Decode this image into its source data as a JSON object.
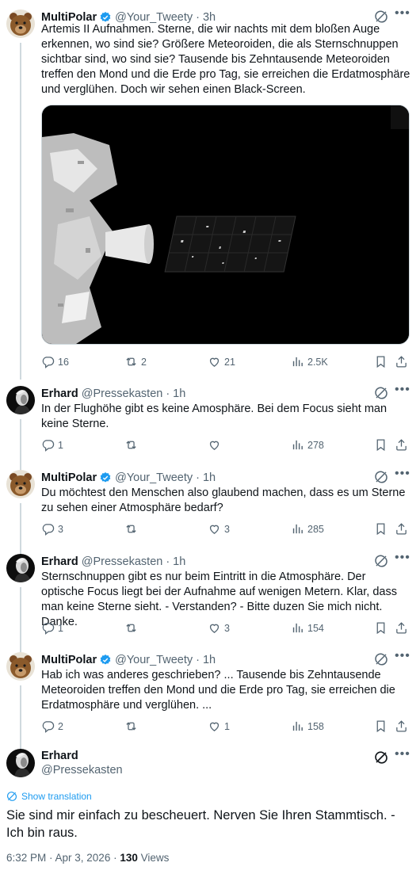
{
  "replies": [
    {
      "author": "MultiPolar",
      "handle": "@Your_Tweety",
      "time": "3h",
      "verified": true,
      "text": "Artemis II Aufnahmen. Sterne, die wir nachts mit dem bloßen Auge erkennen, wo sind sie? Größere Meteoroiden, die als Sternschnuppen sichtbar sind, wo sind sie? Tausende bis Zehntausende Meteoroiden treffen den Mond und die Erde pro Tag, sie erreichen die Erdatmosphäre und verglühen. Doch wir sehen einen Black-Screen.",
      "stats": {
        "replies": "16",
        "reposts": "2",
        "likes": "21",
        "views": "2.5K"
      }
    },
    {
      "author": "Erhard",
      "handle": "@Pressekasten",
      "time": "1h",
      "verified": false,
      "text": "In der Flughöhe gibt es keine Amosphäre. Bei dem Focus sieht man keine Sterne.",
      "stats": {
        "replies": "1",
        "reposts": "",
        "likes": "",
        "views": "278"
      }
    },
    {
      "author": "MultiPolar",
      "handle": "@Your_Tweety",
      "time": "1h",
      "verified": true,
      "text": "Du möchtest den Menschen also glaubend machen, dass es um Sterne zu sehen einer Atmosphäre bedarf?",
      "stats": {
        "replies": "3",
        "reposts": "",
        "likes": "3",
        "views": "285"
      }
    },
    {
      "author": "Erhard",
      "handle": "@Pressekasten",
      "time": "1h",
      "verified": false,
      "text": "Sternschnuppen gibt es nur beim Eintritt in die Atmosphäre. Der optische Focus liegt bei der Aufnahme auf wenigen Metern. Klar, dass man keine Sterne sieht. - Verstanden? - Bitte duzen Sie mich nicht. Danke.",
      "stats": {
        "replies": "1",
        "reposts": "",
        "likes": "3",
        "views": "154"
      }
    },
    {
      "author": "MultiPolar",
      "handle": "@Your_Tweety",
      "time": "1h",
      "verified": true,
      "text": "Hab ich was anderes geschrieben? ... Tausende bis Zehntausende Meteoroiden treffen den Mond und die Erde pro Tag, sie erreichen die Erdatmosphäre und verglühen. ...",
      "stats": {
        "replies": "2",
        "reposts": "",
        "likes": "1",
        "views": "158"
      }
    }
  ],
  "main": {
    "author": "Erhard",
    "handle": "@Pressekasten",
    "show_translation": "Show translation",
    "text": "Sie sind mir einfach zu bescheuert. Nerven Sie Ihren Stammtisch. - Ich bin raus.",
    "date": "6:32 PM · Apr 3, 2026 · ",
    "views_count": "130",
    "views_label": " Views"
  },
  "colors": {
    "accent": "#1d9bf0",
    "muted": "#536471",
    "text": "#0f1419",
    "line": "#cfd9de"
  },
  "icons": [
    "reply-icon",
    "repost-icon",
    "like-icon",
    "views-icon",
    "bookmark-icon",
    "share-icon",
    "grok-icon",
    "more-icon",
    "verified-icon",
    "translate-icon"
  ]
}
